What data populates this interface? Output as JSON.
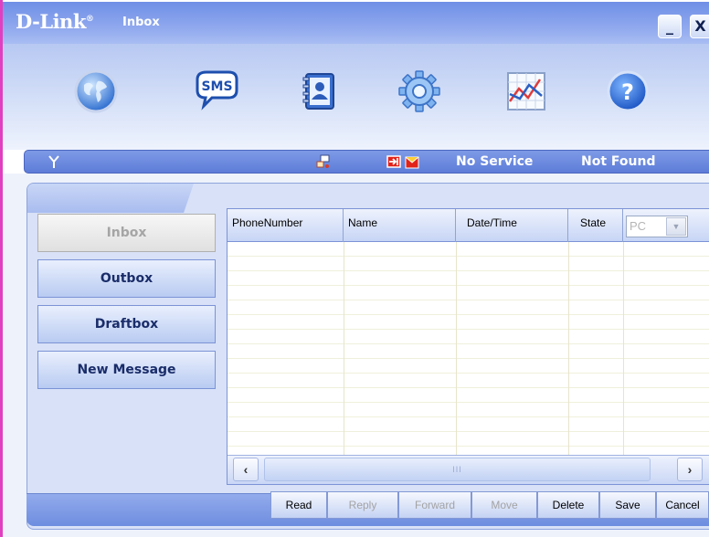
{
  "window": {
    "brand": "D-Link",
    "title": "Inbox",
    "minimize_label": "_",
    "close_label": "X"
  },
  "toolbar": {
    "items": [
      {
        "icon": "globe-icon"
      },
      {
        "icon": "sms-icon",
        "label": "SMS"
      },
      {
        "icon": "phonebook-icon"
      },
      {
        "icon": "gear-icon"
      },
      {
        "icon": "statistics-icon"
      },
      {
        "icon": "help-icon",
        "label": "?"
      }
    ]
  },
  "status": {
    "signal_icon": "antenna-icon",
    "network_icon": "network-icon",
    "sms_icons": [
      "message-in-icon",
      "message-full-icon"
    ],
    "service": "No Service",
    "device": "Not Found"
  },
  "sidebar": {
    "items": [
      {
        "label": "Inbox",
        "active": true
      },
      {
        "label": "Outbox",
        "active": false
      },
      {
        "label": "Draftbox",
        "active": false
      },
      {
        "label": "New Message",
        "active": false
      }
    ]
  },
  "table": {
    "columns": [
      "PhoneNumber",
      "Name",
      "Date/Time",
      "State"
    ],
    "storage_select": {
      "value": "PC"
    },
    "rows": [],
    "scroll_thumb": "III"
  },
  "actions": {
    "buttons": [
      {
        "label": "Read",
        "enabled": true
      },
      {
        "label": "Reply",
        "enabled": false
      },
      {
        "label": "Forward",
        "enabled": false
      },
      {
        "label": "Move",
        "enabled": false
      },
      {
        "label": "Delete",
        "enabled": true
      },
      {
        "label": "Save",
        "enabled": true
      },
      {
        "label": "Cancel",
        "enabled": true
      }
    ]
  },
  "colors": {
    "titlebar": "#7f9ae8",
    "statusbar": "#6d8bdf",
    "panel": "#d8e1f7",
    "button_text": "#1a2d6a",
    "disabled_text": "#a3a3a3"
  }
}
